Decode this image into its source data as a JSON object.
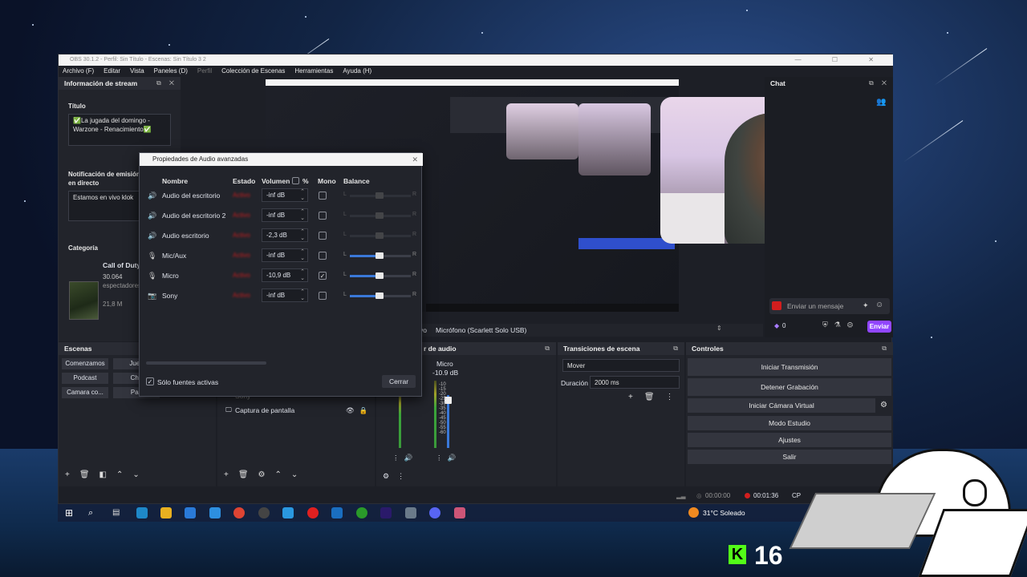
{
  "window": {
    "title": "OBS 30.1.2 - Perfil: Sin Título - Escenas: Sin Título 3 2"
  },
  "menu": [
    "Archivo (F)",
    "Editar",
    "Vista",
    "Paneles (D)",
    "Perfil",
    "Colección de Escenas",
    "Herramientas",
    "Ayuda (H)"
  ],
  "stream_info": {
    "header": "Información de stream",
    "title_label": "Título",
    "title_value": "✅La jugada del domingo - Warzone - Renacimiento✅",
    "notif_label": "Notificación de emisión en directo",
    "notif_value": "Estamos en vivo klok",
    "category_label": "Categoría",
    "category_name": "Call of Duty",
    "category_viewers_count": "30.064",
    "category_viewers_label": "espectadores",
    "category_followers": "21,8 M"
  },
  "dialog": {
    "title": "Propiedades de Audio avanzadas",
    "headers": {
      "name": "Nombre",
      "state": "Estado",
      "volume": "Volumen",
      "pct": "%",
      "mono": "Mono",
      "balance": "Balance"
    },
    "rows": [
      {
        "name": "Audio del escritorio",
        "state": "Activo",
        "volume": "-inf dB",
        "mono": false,
        "bal_L": "L",
        "bal_R": "R"
      },
      {
        "name": "Audio del escritorio 2",
        "state": "Activo",
        "volume": "-inf dB",
        "mono": false,
        "bal_L": "L",
        "bal_R": "R"
      },
      {
        "name": "Audio escritorio",
        "state": "Activo",
        "volume": "-2,3 dB",
        "mono": false,
        "bal_L": "L",
        "bal_R": "R"
      },
      {
        "name": "Mic/Aux",
        "state": "Activo",
        "volume": "-inf dB",
        "mono": false,
        "bal_L": "L",
        "bal_R": "R"
      },
      {
        "name": "Micro",
        "state": "Activo",
        "volume": "-10,9 dB",
        "mono": true,
        "bal_L": "L",
        "bal_R": "R"
      },
      {
        "name": "Sony",
        "state": "Activo",
        "volume": "-inf dB",
        "mono": false,
        "bal_L": "L",
        "bal_R": "R"
      }
    ],
    "active_sources_label": "Sólo fuentes activas",
    "close_label": "Cerrar"
  },
  "chat": {
    "header": "Chat",
    "placeholder": "Enviar un mensaje",
    "send_label": "Enviar",
    "points": "0"
  },
  "mic_label": "vo",
  "mic_source": "Micrófono (Scarlett Solo USB)",
  "scenes": {
    "header": "Escenas",
    "items": [
      "Comenzamos",
      "Jueg",
      "Podcast",
      "Cha",
      "Camara co...",
      "Pau"
    ]
  },
  "sources": {
    "items": [
      "Sony",
      "Captura de pantalla"
    ]
  },
  "mixer": {
    "header": "r de audio",
    "channel_name": "Micro",
    "channel_db": "-10.9 dB",
    "ticks": [
      "-10",
      "-15",
      "-20",
      "-25",
      "-30",
      "-35",
      "-40",
      "-45",
      "-50",
      "-55",
      "-60"
    ]
  },
  "transitions": {
    "header": "Transiciones de escena",
    "type": "Mover",
    "duration_label": "Duración",
    "duration_value": "2000 ms"
  },
  "controls": {
    "header": "Controles",
    "buttons": [
      "Iniciar Transmisión",
      "Detener Grabación",
      "Iniciar Cámara Virtual",
      "Modo Estudio",
      "Ajustes",
      "Salir"
    ]
  },
  "statusbar": {
    "stream_time": "00:00:00",
    "rec_time": "00:01:36",
    "cpu": "CP"
  },
  "taskbar": {
    "weather": "31°C Soleado"
  },
  "overlay": {
    "counter": "16",
    "logo": "K"
  },
  "colors": {
    "accent": "#2f4fcc",
    "twitch": "#9146ff",
    "rec": "#d21e1e"
  }
}
